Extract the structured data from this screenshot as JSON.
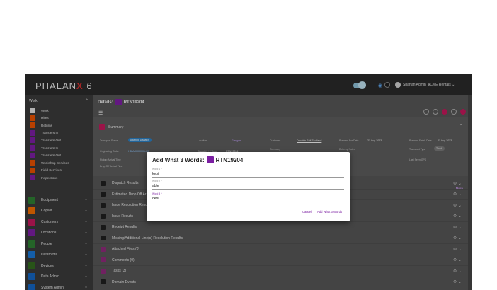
{
  "topbar": {
    "logo_text": "PHALAN",
    "logo_x": "X",
    "logo_version": " 6",
    "user": "Spartan Admin ⌄",
    "tenant": "ACME Rentals ⌄"
  },
  "sidebar": {
    "work_heading": "Work",
    "items": [
      {
        "label": "Work",
        "color": "#e0e0e0"
      },
      {
        "label": "Hires",
        "color": "#e65100"
      },
      {
        "label": "Returns",
        "color": "#e65100"
      },
      {
        "label": "Transfers In",
        "color": "#7b1fa2"
      },
      {
        "label": "Transfers Out",
        "color": "#7b1fa2"
      },
      {
        "label": "Transfers In",
        "color": "#7b1fa2"
      },
      {
        "label": "Transfers Out",
        "color": "#7b1fa2"
      },
      {
        "label": "Workshop Services",
        "color": "#e65100"
      },
      {
        "label": "Field Services",
        "color": "#e65100"
      },
      {
        "label": "Inspections",
        "color": "#7b1fa2"
      }
    ],
    "groups": [
      {
        "label": "Equipment",
        "color": "#2e7d32"
      },
      {
        "label": "Copilot",
        "color": "#ef6c00"
      },
      {
        "label": "Customers",
        "color": "#c2185b"
      },
      {
        "label": "Locations",
        "color": "#7b1fa2"
      },
      {
        "label": "People",
        "color": "#2e7d32"
      },
      {
        "label": "Dataforms",
        "color": "#1976d2"
      },
      {
        "label": "Devices",
        "color": "#33691e"
      },
      {
        "label": "Data Admin",
        "color": "#1565c0"
      },
      {
        "label": "System Admin",
        "color": "#1565c0"
      }
    ]
  },
  "main": {
    "details_prefix": "Details:",
    "record_id": "RTN19204",
    "summary_label": "Summary",
    "fields": {
      "transport_status_lbl": "Transport Status",
      "transport_status_val": "Awaiting Dispatch",
      "location_lbl": "Location",
      "location_val": "Glasgow",
      "customer_lbl": "Customer",
      "customer_val": "Donalds Self Scotland",
      "planned_on_lbl": "Planned For Date",
      "planned_on_val": "21 Aug 2023",
      "planned_return_lbl": "Planned Finish Date",
      "planned_return_val": "21 Aug 2023",
      "originating_lbl": "Originating Order",
      "originating_val": "HD-A-0000001-00",
      "dispatch_lbl": "Dispatch + / Time",
      "dispatch_val": "RTN19204",
      "company_lbl": "Company",
      "delivery_lbl": "Delivery Notes",
      "transport_type_lbl": "Transport Type",
      "transport_type_val": "Truck",
      "pickup_lbl": "Pickup Arrival Time",
      "dropoff_lbl": "Drop Off Arrival Time",
      "last_edit_lbl": "Last Seen GPS",
      "more": "More"
    },
    "sections": [
      {
        "label": "Dispatch Results",
        "pink": false
      },
      {
        "label": "Estimated Drop Off Ar",
        "pink": false
      },
      {
        "label": "Issue Resolution Result",
        "pink": false
      },
      {
        "label": "Issue Results",
        "pink": false
      },
      {
        "label": "Receipt Results",
        "pink": false
      },
      {
        "label": "Missing/Additional Line(s) Resolution Results",
        "pink": false
      },
      {
        "label": "Attached Files (0)",
        "pink": true
      },
      {
        "label": "Comments (0)",
        "pink": true
      },
      {
        "label": "Tasks (3)",
        "pink": true
      },
      {
        "label": "Domain Events",
        "pink": false
      }
    ],
    "section_right": "⚙ ⌄"
  },
  "dialog": {
    "title_prefix": "Add What 3 Words:",
    "record_id": "RTN19204",
    "word1_label": "Word 1 *",
    "word1_value": "kept",
    "word2_label": "Word 2 *",
    "word2_value": "able",
    "word3_label": "Word 3 *",
    "word3_value": "deni",
    "cancel_label": "Cancel",
    "submit_label": "Add What 3 Words"
  }
}
